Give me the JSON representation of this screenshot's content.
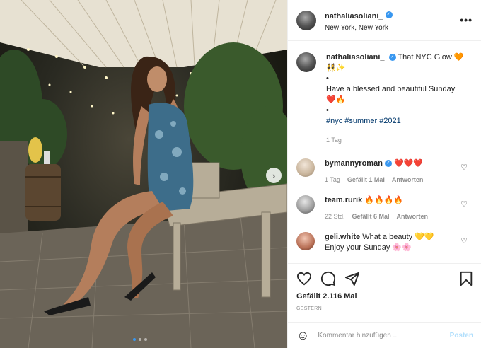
{
  "post": {
    "username": "nathaliasoliani_",
    "location": "New York, New York",
    "more_label": "•••"
  },
  "caption": {
    "username": "nathaliasoliani_",
    "text_line1": "That NYC Glow",
    "line1_emoji": "🧡",
    "line2_emoji": "👯✨",
    "bullet1": "•",
    "text_line3": "Have a blessed and beautiful Sunday",
    "line4_emoji": "❤️🔥",
    "bullet2": "•",
    "hashtags": "#nyc #summer #2021",
    "time": "1 Tag"
  },
  "comments": [
    {
      "username": "bymannyroman",
      "text": "",
      "emoji": "❤️❤️❤️",
      "verified": true,
      "time": "1 Tag",
      "likes": "Gefällt 1 Mal",
      "reply": "Antworten"
    },
    {
      "username": "team.rurik",
      "text": "",
      "emoji": "🔥🔥🔥🔥",
      "verified": false,
      "time": "22 Std.",
      "likes": "Gefällt 6 Mal",
      "reply": "Antworten"
    },
    {
      "username": "geli.white",
      "text": "What a beauty",
      "emoji": "💛💛",
      "text2": "Enjoy your Sunday",
      "emoji2": "🌸🌸",
      "verified": false
    }
  ],
  "likes_count": "Gefällt 2.116 Mal",
  "date": "GESTERN",
  "add_comment": {
    "placeholder": "Kommentar hinzufügen ...",
    "post_label": "Posten"
  },
  "colors": {
    "verified": "#3897f0",
    "link": "#00376b",
    "muted": "#8e8e8e",
    "post_disabled": "#b2dffc"
  }
}
